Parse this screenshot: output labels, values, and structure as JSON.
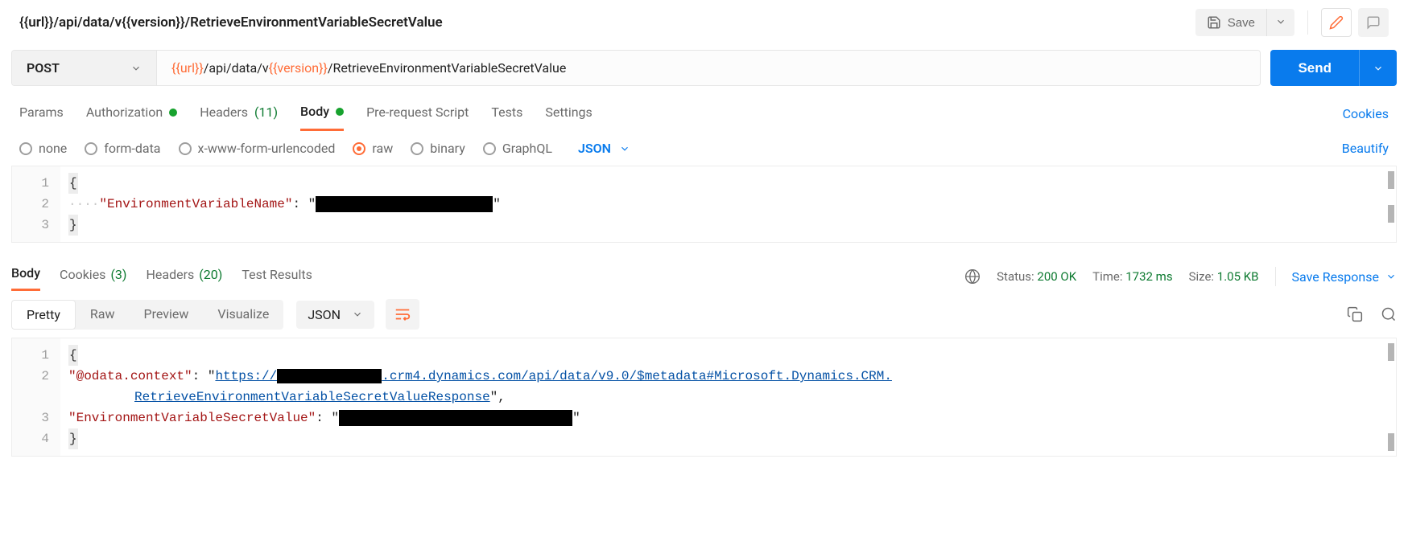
{
  "title": "{{url}}/api/data/v{{version}}/RetrieveEnvironmentVariableSecretValue",
  "save_label": "Save",
  "method": "POST",
  "url": {
    "v1": "{{url}}",
    "s1": "/api/data/v",
    "v2": "{{version}}",
    "s2": "/RetrieveEnvironmentVariableSecretValue"
  },
  "send_label": "Send",
  "tabs": {
    "params": "Params",
    "auth": "Authorization",
    "headers": "Headers",
    "headers_count": "(11)",
    "body": "Body",
    "prereq": "Pre-request Script",
    "tests": "Tests",
    "settings": "Settings",
    "cookies_link": "Cookies"
  },
  "body_types": {
    "none": "none",
    "formdata": "form-data",
    "urlenc": "x-www-form-urlencoded",
    "raw": "raw",
    "binary": "binary",
    "graphql": "GraphQL",
    "lang": "JSON",
    "beautify": "Beautify"
  },
  "req_body": {
    "lines": [
      "1",
      "2",
      "3"
    ],
    "key": "\"EnvironmentVariableName\"",
    "colon": ": ",
    "open_q": "\"",
    "close_q": "\""
  },
  "resp_tabs": {
    "body": "Body",
    "cookies": "Cookies",
    "cookies_count": "(3)",
    "headers": "Headers",
    "headers_count": "(20)",
    "tests": "Test Results"
  },
  "status": {
    "status_label": "Status:",
    "status_val": "200 OK",
    "time_label": "Time:",
    "time_val": "1732 ms",
    "size_label": "Size:",
    "size_val": "1.05 KB",
    "save_resp": "Save Response"
  },
  "views": {
    "pretty": "Pretty",
    "raw": "Raw",
    "preview": "Preview",
    "visualize": "Visualize",
    "lang": "JSON"
  },
  "resp_body": {
    "lines": [
      "1",
      "2",
      "3",
      "4"
    ],
    "k1": "\"@odata.context\"",
    "colon": ": ",
    "q": "\"",
    "url_pre": "https://",
    "url_mid": ".crm4.dynamics.com/api/data/v9.0/$metadata#Microsoft.Dynamics.CRM.",
    "url_wrap": "RetrieveEnvironmentVariableSecretValueResponse",
    "comma": ",",
    "k2": "\"EnvironmentVariableSecretValue\""
  }
}
